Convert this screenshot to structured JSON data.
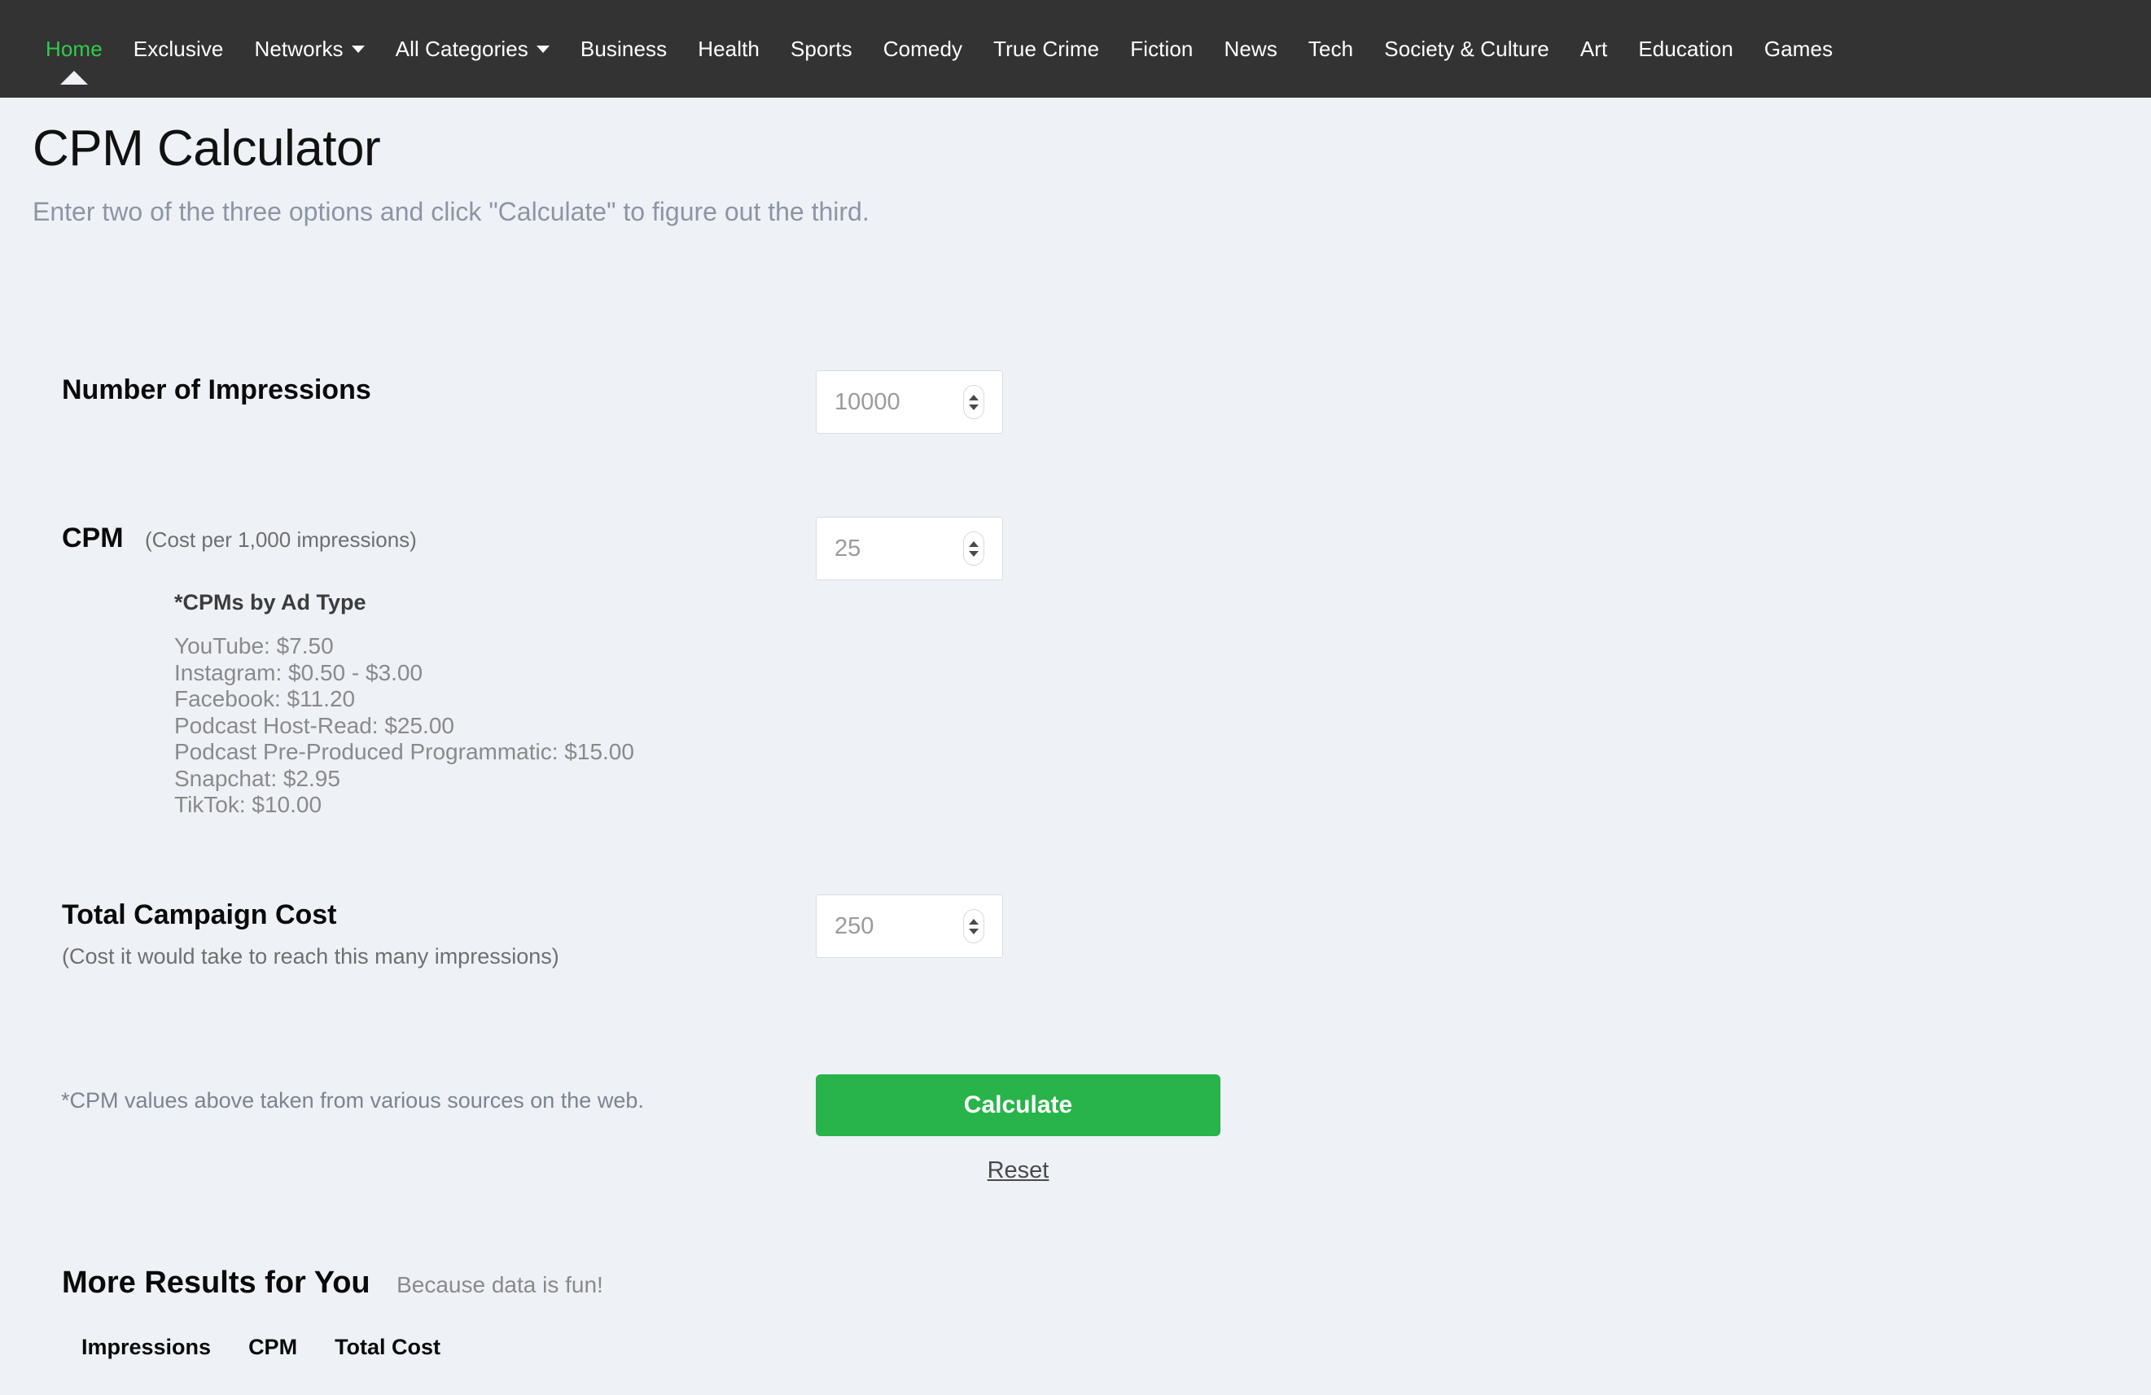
{
  "nav": {
    "items": [
      {
        "label": "Home",
        "active": true,
        "caret": false,
        "pointer": true
      },
      {
        "label": "Exclusive",
        "active": false,
        "caret": false,
        "pointer": false
      },
      {
        "label": "Networks",
        "active": false,
        "caret": true,
        "pointer": false
      },
      {
        "label": "All Categories",
        "active": false,
        "caret": true,
        "pointer": false
      },
      {
        "label": "Business",
        "active": false,
        "caret": false,
        "pointer": false
      },
      {
        "label": "Health",
        "active": false,
        "caret": false,
        "pointer": false
      },
      {
        "label": "Sports",
        "active": false,
        "caret": false,
        "pointer": false
      },
      {
        "label": "Comedy",
        "active": false,
        "caret": false,
        "pointer": false
      },
      {
        "label": "True Crime",
        "active": false,
        "caret": false,
        "pointer": false
      },
      {
        "label": "Fiction",
        "active": false,
        "caret": false,
        "pointer": false
      },
      {
        "label": "News",
        "active": false,
        "caret": false,
        "pointer": false
      },
      {
        "label": "Tech",
        "active": false,
        "caret": false,
        "pointer": false
      },
      {
        "label": "Society & Culture",
        "active": false,
        "caret": false,
        "pointer": false
      },
      {
        "label": "Art",
        "active": false,
        "caret": false,
        "pointer": false
      },
      {
        "label": "Education",
        "active": false,
        "caret": false,
        "pointer": false
      },
      {
        "label": "Games",
        "active": false,
        "caret": false,
        "pointer": false
      }
    ],
    "active_color": "#2ecc4a",
    "background_color": "#333333"
  },
  "header": {
    "title": "CPM Calculator",
    "subtitle": "Enter two of the three options and click \"Calculate\" to figure out the third."
  },
  "form": {
    "impressions": {
      "label": "Number of Impressions",
      "placeholder": "10000",
      "value": ""
    },
    "cpm": {
      "label": "CPM",
      "sublabel": "(Cost per 1,000 impressions)",
      "placeholder": "25",
      "value": "",
      "note_title": "*CPMs by Ad Type",
      "ad_types": [
        "YouTube: $7.50",
        "Instagram: $0.50 - $3.00",
        "Facebook: $11.20",
        "Podcast Host-Read: $25.00",
        "Podcast Pre-Produced Programmatic: $15.00",
        "Snapchat: $2.95",
        "TikTok: $10.00"
      ]
    },
    "total_cost": {
      "label": "Total Campaign Cost",
      "sublabel": "(Cost it would take to reach this many impressions)",
      "placeholder": "250",
      "value": ""
    },
    "footnote": "*CPM values above taken from various sources on the web.",
    "calculate_label": "Calculate",
    "reset_label": "Reset",
    "calculate_color": "#28b44a"
  },
  "more_results": {
    "title": "More Results for You",
    "tagline": "Because data is fun!",
    "columns": [
      "Impressions",
      "CPM",
      "Total Cost"
    ],
    "rows": []
  }
}
